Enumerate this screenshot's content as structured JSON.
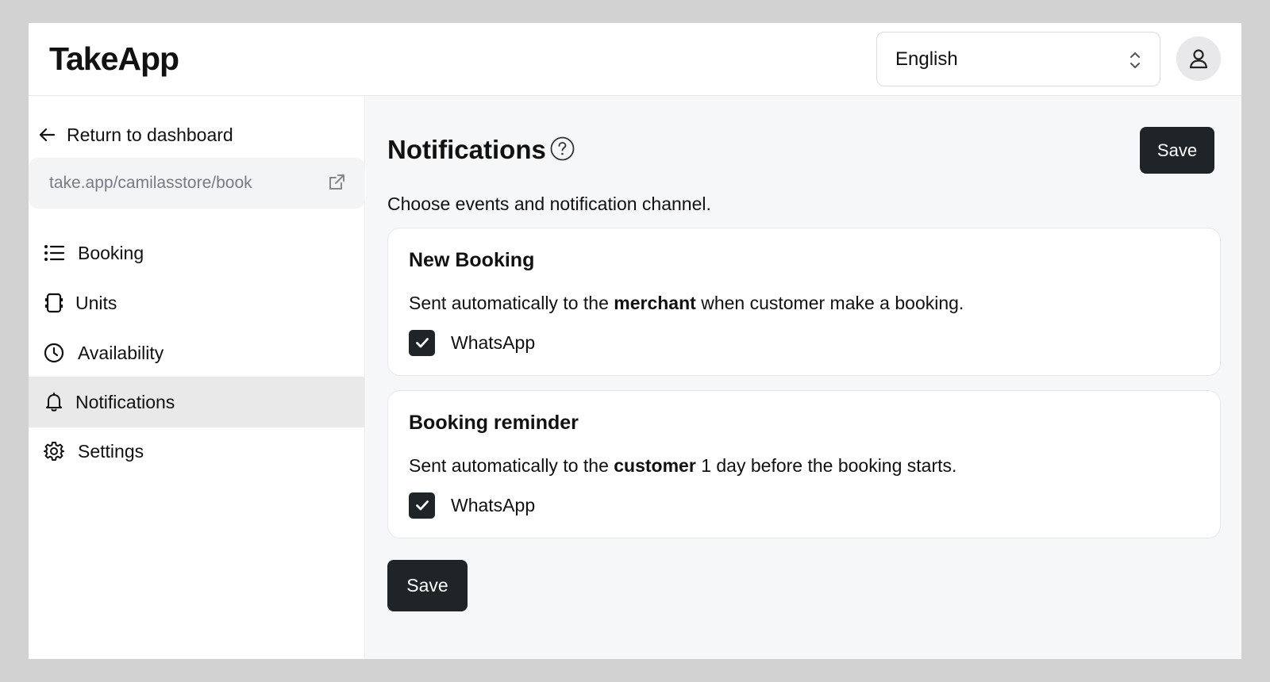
{
  "app": {
    "logo": "TakeApp"
  },
  "header": {
    "language": {
      "value": "English"
    }
  },
  "sidebar": {
    "back_label": "Return to dashboard",
    "store_url": "take.app/camilasstore/book",
    "items": [
      {
        "label": "Booking",
        "icon": "list-icon"
      },
      {
        "label": "Units",
        "icon": "tablet-icon"
      },
      {
        "label": "Availability",
        "icon": "clock-icon"
      },
      {
        "label": "Notifications",
        "icon": "bell-icon",
        "active": true
      },
      {
        "label": "Settings",
        "icon": "gear-icon"
      }
    ]
  },
  "main": {
    "title": "Notifications",
    "save_label": "Save",
    "subtitle": "Choose events and notification channel.",
    "cards": [
      {
        "title": "New Booking",
        "desc_before": "Sent automatically to the ",
        "desc_bold": "merchant",
        "desc_after": " when customer make a booking.",
        "channel": "WhatsApp",
        "checked": true
      },
      {
        "title": "Booking reminder",
        "desc_before": "Sent automatically to the ",
        "desc_bold": "customer",
        "desc_after": " 1 day before the booking starts.",
        "channel": "WhatsApp",
        "checked": true
      }
    ],
    "save_bottom_label": "Save"
  },
  "colors": {
    "button_dark": "#1f2429",
    "active_nav_bg": "#e9e9ea",
    "main_bg": "#f6f7f9"
  }
}
